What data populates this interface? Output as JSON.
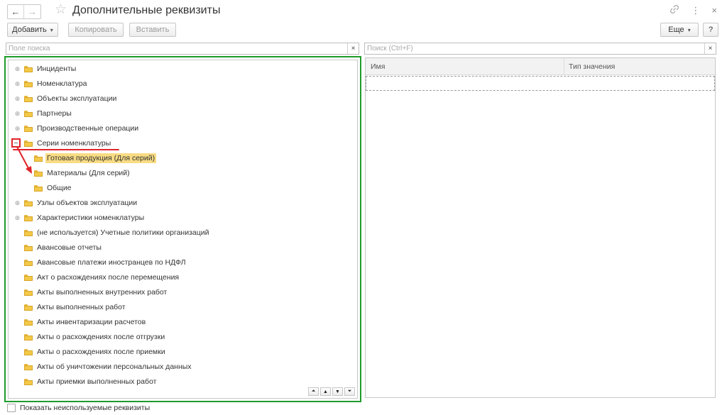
{
  "window": {
    "title": "Дополнительные реквизиты",
    "back_icon": "←",
    "forward_icon": "→",
    "star_icon": "☆",
    "link_icon": "🔗",
    "menu_icon": "⋮",
    "close_icon": "×"
  },
  "toolbar": {
    "add_label": "Добавить",
    "copy_label": "Копировать",
    "paste_label": "Вставить",
    "more_label": "Еще",
    "help_label": "?"
  },
  "tree_search": {
    "placeholder": "Поле поиска",
    "clear": "×"
  },
  "grid_search": {
    "placeholder": "Поиск (Ctrl+F)",
    "clear": "×"
  },
  "tree": {
    "items": [
      {
        "label": "Инциденты"
      },
      {
        "label": "Номенклатура"
      },
      {
        "label": "Объекты эксплуатации"
      },
      {
        "label": "Партнеры"
      },
      {
        "label": "Производственные операции"
      },
      {
        "label": "Серии номенклатуры"
      },
      {
        "label": "Готовая продукция (Для серий)"
      },
      {
        "label": "Материалы (Для серий)"
      },
      {
        "label": "Общие"
      },
      {
        "label": "Узлы объектов эксплуатации"
      },
      {
        "label": "Характеристики номенклатуры"
      },
      {
        "label": "(не используется) Учетные политики организаций"
      },
      {
        "label": "Авансовые отчеты"
      },
      {
        "label": "Авансовые платежи иностранцев по НДФЛ"
      },
      {
        "label": "Акт о расхождениях после перемещения"
      },
      {
        "label": "Акты выполненных внутренних работ"
      },
      {
        "label": "Акты выполненных работ"
      },
      {
        "label": "Акты инвентаризации расчетов"
      },
      {
        "label": "Акты о расхождениях после отгрузки"
      },
      {
        "label": "Акты о расхождениях после приемки"
      },
      {
        "label": "Акты об уничтожении персональных данных"
      },
      {
        "label": "Акты приемки выполненных работ"
      }
    ]
  },
  "tree_expand_icon": "⊕",
  "grid": {
    "col_name": "Имя",
    "col_type": "Тип значения"
  },
  "footer": {
    "show_unused_label": "Показать неиспользуемые реквизиты"
  },
  "colors": {
    "highlight_frame": "#1e9c2b",
    "annotation": "#e0242a",
    "selection": "#f8dc84"
  }
}
